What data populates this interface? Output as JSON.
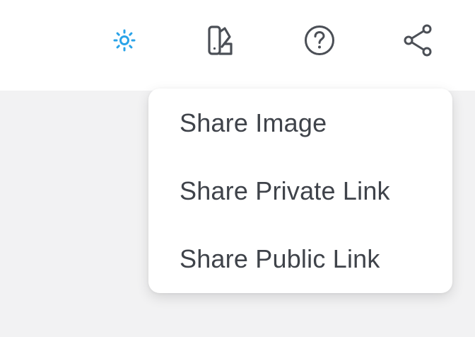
{
  "toolbar": {
    "icons": {
      "theme": "sun-icon",
      "palette": "palette-icon",
      "help": "help-circle-icon",
      "share": "share-icon"
    },
    "colors": {
      "theme_icon": "#2aa3e8",
      "default_icon": "#4b4f56"
    }
  },
  "share_menu": {
    "items": [
      {
        "label": "Share Image"
      },
      {
        "label": "Share Private Link"
      },
      {
        "label": "Share Public Link"
      }
    ]
  }
}
